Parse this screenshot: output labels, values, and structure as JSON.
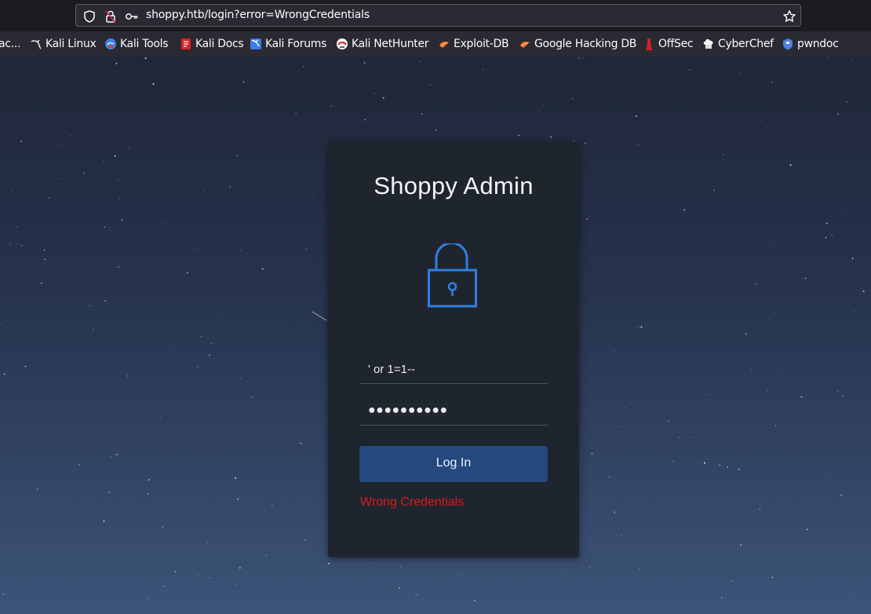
{
  "browser": {
    "url": "shoppy.htb/login?error=WrongCredentials",
    "icons": [
      "shield-icon",
      "insecure-lock-icon",
      "key-icon",
      "bookmark-star-icon"
    ]
  },
  "bookmarks": [
    {
      "label": "ac...",
      "icon": "truncated-bookmark"
    },
    {
      "label": "Kali Linux",
      "icon": "kali-dragon-icon"
    },
    {
      "label": "Kali Tools",
      "icon": "kali-tools-icon"
    },
    {
      "label": "Kali Docs",
      "icon": "kali-docs-icon"
    },
    {
      "label": "Kali Forums",
      "icon": "kali-forums-icon"
    },
    {
      "label": "Kali NetHunter",
      "icon": "kali-nethunter-icon"
    },
    {
      "label": "Exploit-DB",
      "icon": "exploit-db-icon"
    },
    {
      "label": "Google Hacking DB",
      "icon": "google-hacking-db-icon"
    },
    {
      "label": "OffSec",
      "icon": "offsec-icon"
    },
    {
      "label": "CyberChef",
      "icon": "cyberchef-icon"
    },
    {
      "label": "pwndoc",
      "icon": "pwndoc-icon"
    }
  ],
  "login": {
    "title": "Shoppy Admin",
    "icon": "padlock-icon",
    "username_value": "' or 1=1--",
    "password_value": "●●●●●●●●●●",
    "button_label": "Log In",
    "error_text": "Wrong Credentials"
  },
  "colors": {
    "accent": "#2f7fe0",
    "button": "#23497f",
    "error": "#dc1a1a",
    "card": "#1f252f"
  }
}
